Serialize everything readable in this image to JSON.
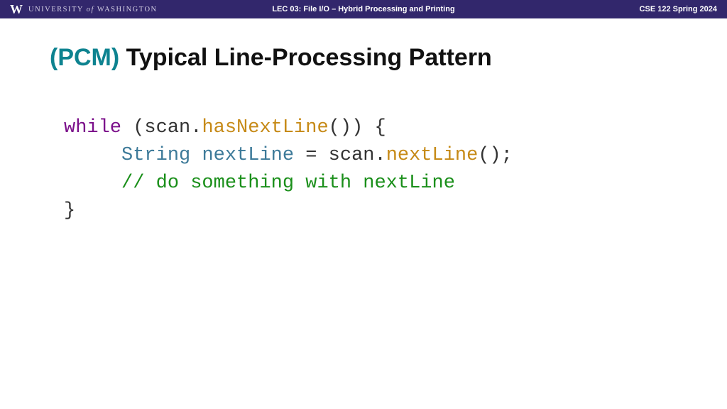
{
  "header": {
    "university": "UNIVERSITY of WASHINGTON",
    "lecture": "LEC 03: File I/O – Hybrid Processing and Printing",
    "course": "CSE 122 Spring 2024"
  },
  "title": {
    "prefix": "(PCM)",
    "rest": " Typical Line-Processing Pattern"
  },
  "code": {
    "l1_kw": "while",
    "l1_open": " (scan.",
    "l1_meth": "hasNextLine",
    "l1_close": "()) {",
    "l2_indent": "     ",
    "l2_type": "String",
    "l2_sp": " ",
    "l2_var": "nextLine",
    "l2_eq": " = scan.",
    "l2_meth": "nextLine",
    "l2_end": "();",
    "l3_indent": "     ",
    "l3_cmt": "// do something with nextLine",
    "l4": "}"
  }
}
